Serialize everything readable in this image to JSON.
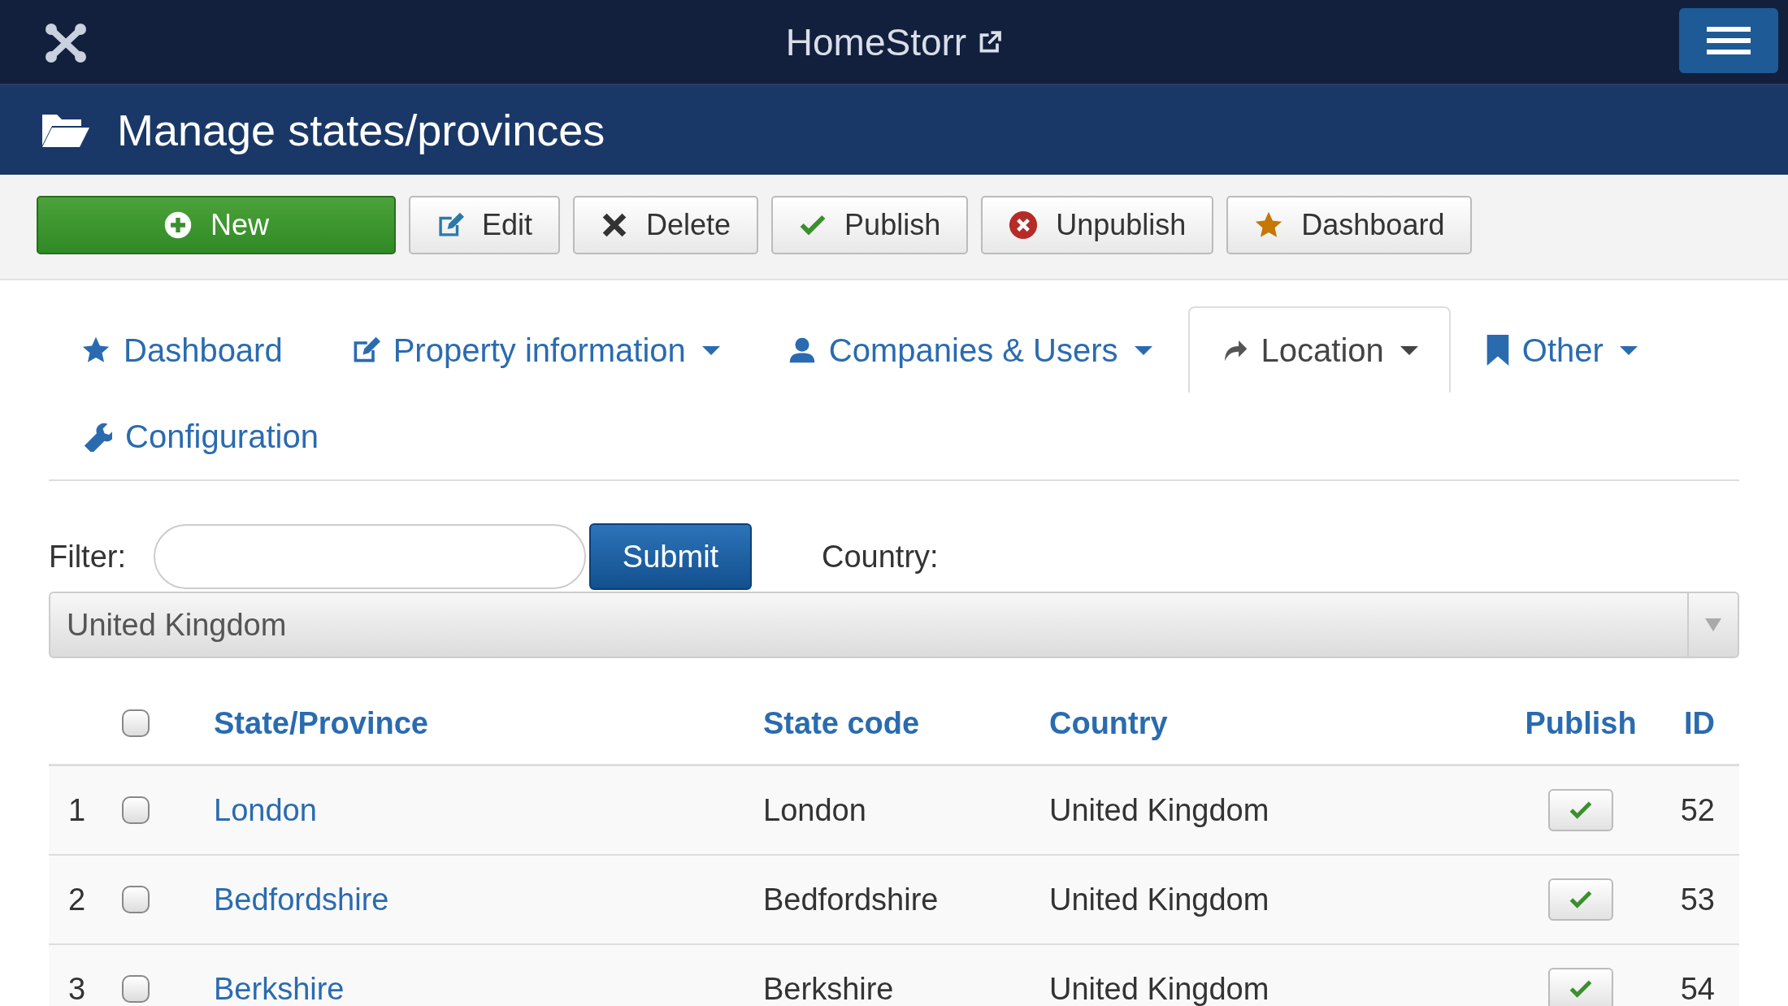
{
  "top_bar": {
    "site_name": "HomeStorr"
  },
  "title_bar": {
    "title": "Manage states/provinces"
  },
  "toolbar": [
    {
      "label": "New",
      "kind": "new"
    },
    {
      "label": "Edit",
      "kind": "edit"
    },
    {
      "label": "Delete",
      "kind": "delete"
    },
    {
      "label": "Publish",
      "kind": "publish"
    },
    {
      "label": "Unpublish",
      "kind": "unpublish"
    },
    {
      "label": "Dashboard",
      "kind": "dashboard"
    }
  ],
  "nav_tabs": [
    {
      "label": "Dashboard",
      "kind": "star",
      "dropdown": false,
      "selected": false
    },
    {
      "label": "Property information",
      "kind": "edit",
      "dropdown": true,
      "selected": false
    },
    {
      "label": "Companies & Users",
      "kind": "user",
      "dropdown": true,
      "selected": false
    },
    {
      "label": "Location",
      "kind": "share",
      "dropdown": true,
      "selected": true
    },
    {
      "label": "Other",
      "kind": "bookmark",
      "dropdown": true,
      "selected": false
    },
    {
      "label": "Configuration",
      "kind": "wrench",
      "dropdown": false,
      "selected": false
    }
  ],
  "filter": {
    "label": "Filter:",
    "submit": "Submit",
    "country_label": "Country:",
    "country_value": "United Kingdom"
  },
  "table": {
    "columns": [
      "State/Province",
      "State code",
      "Country",
      "Publish",
      "ID"
    ],
    "select_all_checked": false,
    "rows": [
      {
        "number": "1",
        "checked": false,
        "name": "London",
        "code": "London",
        "country": "United Kingdom",
        "published": true,
        "id": "52"
      },
      {
        "number": "2",
        "checked": false,
        "name": "Bedfordshire",
        "code": "Bedfordshire",
        "country": "United Kingdom",
        "published": true,
        "id": "53"
      },
      {
        "number": "3",
        "checked": false,
        "name": "Berkshire",
        "code": "Berkshire",
        "country": "United Kingdom",
        "published": true,
        "id": "54"
      }
    ]
  }
}
